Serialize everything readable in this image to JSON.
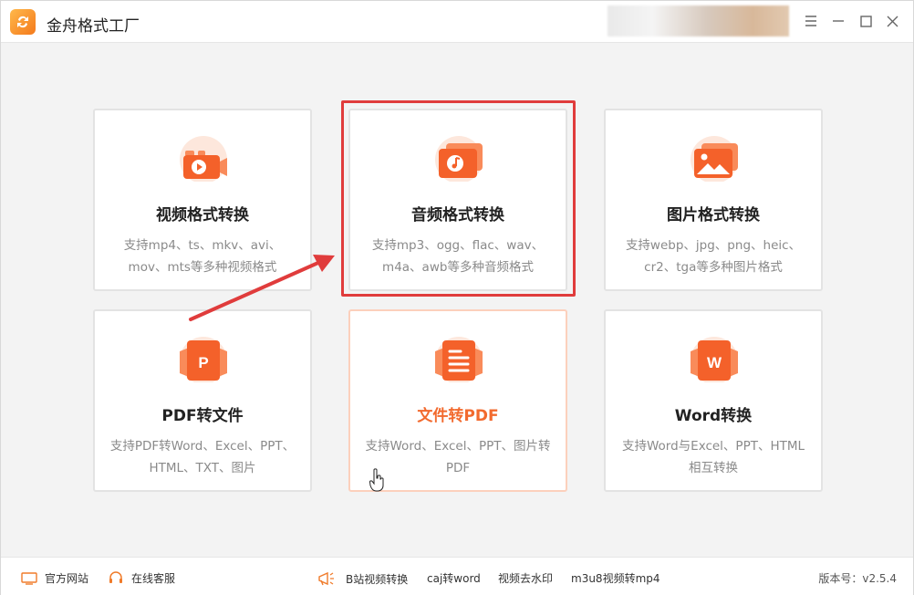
{
  "app": {
    "title": "金舟格式工厂"
  },
  "cards": [
    {
      "title": "视频格式转换",
      "desc": "支持mp4、ts、mkv、avi、mov、mts等多种视频格式",
      "icon": "video-icon"
    },
    {
      "title": "音频格式转换",
      "desc": "支持mp3、ogg、flac、wav、m4a、awb等多种音频格式",
      "icon": "audio-icon"
    },
    {
      "title": "图片格式转换",
      "desc": "支持webp、jpg、png、heic、cr2、tga等多种图片格式",
      "icon": "image-icon"
    },
    {
      "title": "PDF转文件",
      "desc": "支持PDF转Word、Excel、PPT、HTML、TXT、图片",
      "icon": "pdf-icon"
    },
    {
      "title": "文件转PDF",
      "desc": "支持Word、Excel、PPT、图片转PDF",
      "icon": "document-icon"
    },
    {
      "title": "Word转换",
      "desc": "支持Word与Excel、PPT、HTML相互转换",
      "icon": "word-icon"
    }
  ],
  "footer": {
    "website": "官方网站",
    "support": "在线客服",
    "links": [
      "B站视频转换",
      "caj转word",
      "视频去水印",
      "m3u8视频转mp4"
    ],
    "version": "版本号：v2.5.4"
  },
  "colors": {
    "accent": "#f26a2e",
    "highlight": "#e03c3c"
  }
}
